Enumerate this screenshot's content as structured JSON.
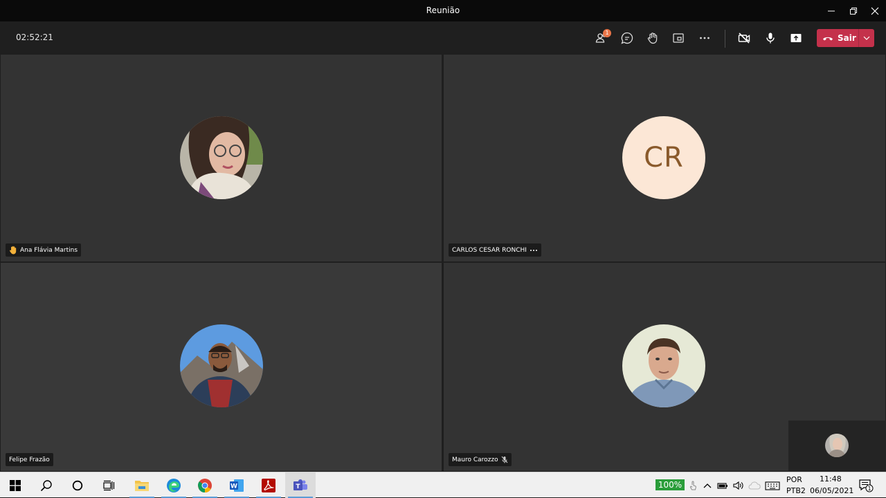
{
  "window": {
    "title": "Reunião"
  },
  "toolbar": {
    "timer": "02:52:21",
    "participants_badge": "1",
    "leave_label": "Sair"
  },
  "participants": [
    {
      "name": "Ana Flávia Martins",
      "hand_raised": true
    },
    {
      "name": "CARLOS CESAR RONCHI",
      "initials": "CR"
    },
    {
      "name": "Felipe Frazão"
    },
    {
      "name": "Mauro Carozzo",
      "muted": true
    }
  ],
  "taskbar": {
    "battery": "100%",
    "language_top": "POR",
    "language_bottom": "PTB2",
    "time": "11:48",
    "date": "06/05/2021",
    "notifications_count": "1"
  },
  "colors": {
    "leave": "#c4314b",
    "badge": "#e97548",
    "initials_bg": "#fce7d6",
    "initials_fg": "#8a5a2b"
  }
}
